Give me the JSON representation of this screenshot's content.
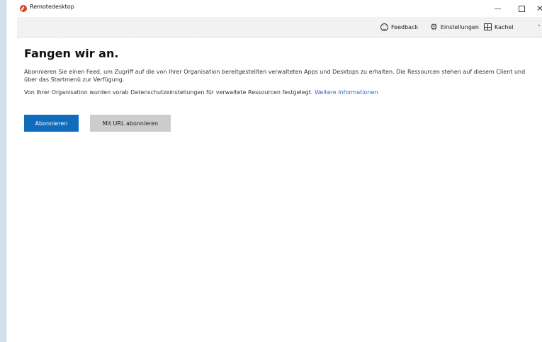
{
  "window": {
    "title": "Remotedesktop",
    "close_glyph": "✕"
  },
  "commandbar": {
    "feedback_label": "Feedback",
    "settings_label": "Einstellungen",
    "tile_label": "Kachel",
    "more_label": "···"
  },
  "main": {
    "heading": "Fangen wir an.",
    "description": "Abonnieren Sie einen Feed, um Zugriff auf die von Ihrer Organisation bereitgestellten verwalteten Apps und Desktops zu erhalten. Die Ressourcen stehen auf diesem Client und über das Startmenü zur Verfügung.",
    "privacy_text": "Von Ihrer Organisation wurden vorab Datenschutzeinstellungen für verwaltete Ressourcen festgelegt.",
    "more_info_link": "Weitere Informationen",
    "subscribe_button": "Abonnieren",
    "subscribe_url_button": "Mit URL abonnieren"
  },
  "colors": {
    "accent": "#0f6cbd",
    "link": "#2a6cc4",
    "secondary_button": "#cccccc",
    "commandbar_bg": "#f2f2f2"
  },
  "icons": {
    "app": "remote-desktop-logo",
    "feedback": "smiley-icon",
    "settings": "gear-icon",
    "tile": "tile-grid-icon"
  }
}
